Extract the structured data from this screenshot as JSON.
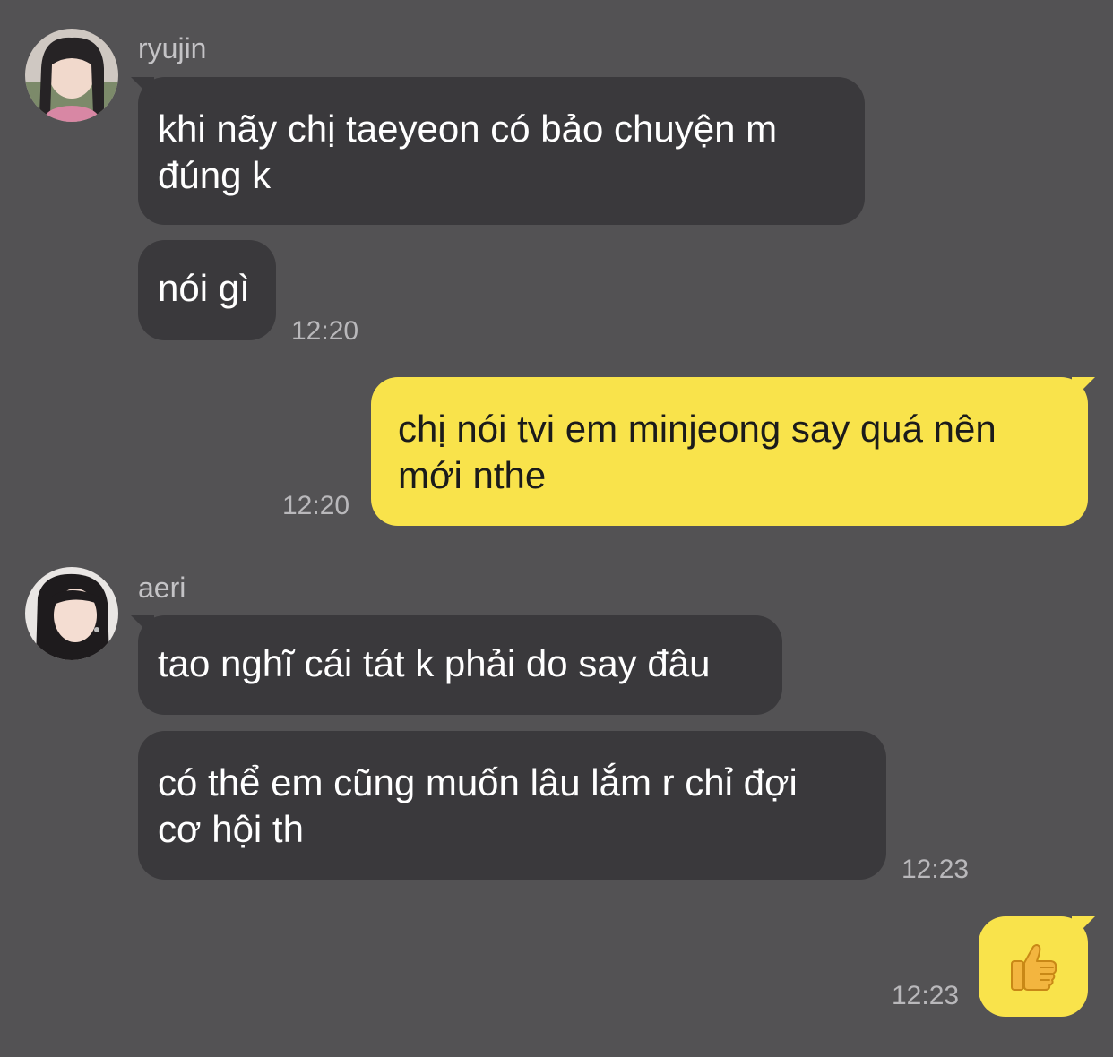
{
  "messages": [
    {
      "sender": "ryujin",
      "bubbles": [
        {
          "text": "khi nãy chị taeyeon có bảo chuyện m\nđúng k"
        },
        {
          "text": "nói gì",
          "time": "12:20"
        }
      ]
    },
    {
      "sender": "me",
      "bubbles": [
        {
          "text": "chị nói tvi em minjeong say quá nên\nmới nthe",
          "time": "12:20"
        }
      ]
    },
    {
      "sender": "aeri",
      "bubbles": [
        {
          "text": "tao nghĩ cái tát k phải do say đâu"
        },
        {
          "text": "có thể em cũng muốn lâu lắm r chỉ đợi\ncơ hội th",
          "time": "12:23"
        }
      ]
    },
    {
      "sender": "me",
      "bubbles": [
        {
          "emoji": "thumbs-up-icon",
          "time": "12:23"
        }
      ]
    }
  ],
  "colors": {
    "background": "#535254",
    "incoming_bubble": "#3a393c",
    "outgoing_bubble": "#f9e34b"
  }
}
